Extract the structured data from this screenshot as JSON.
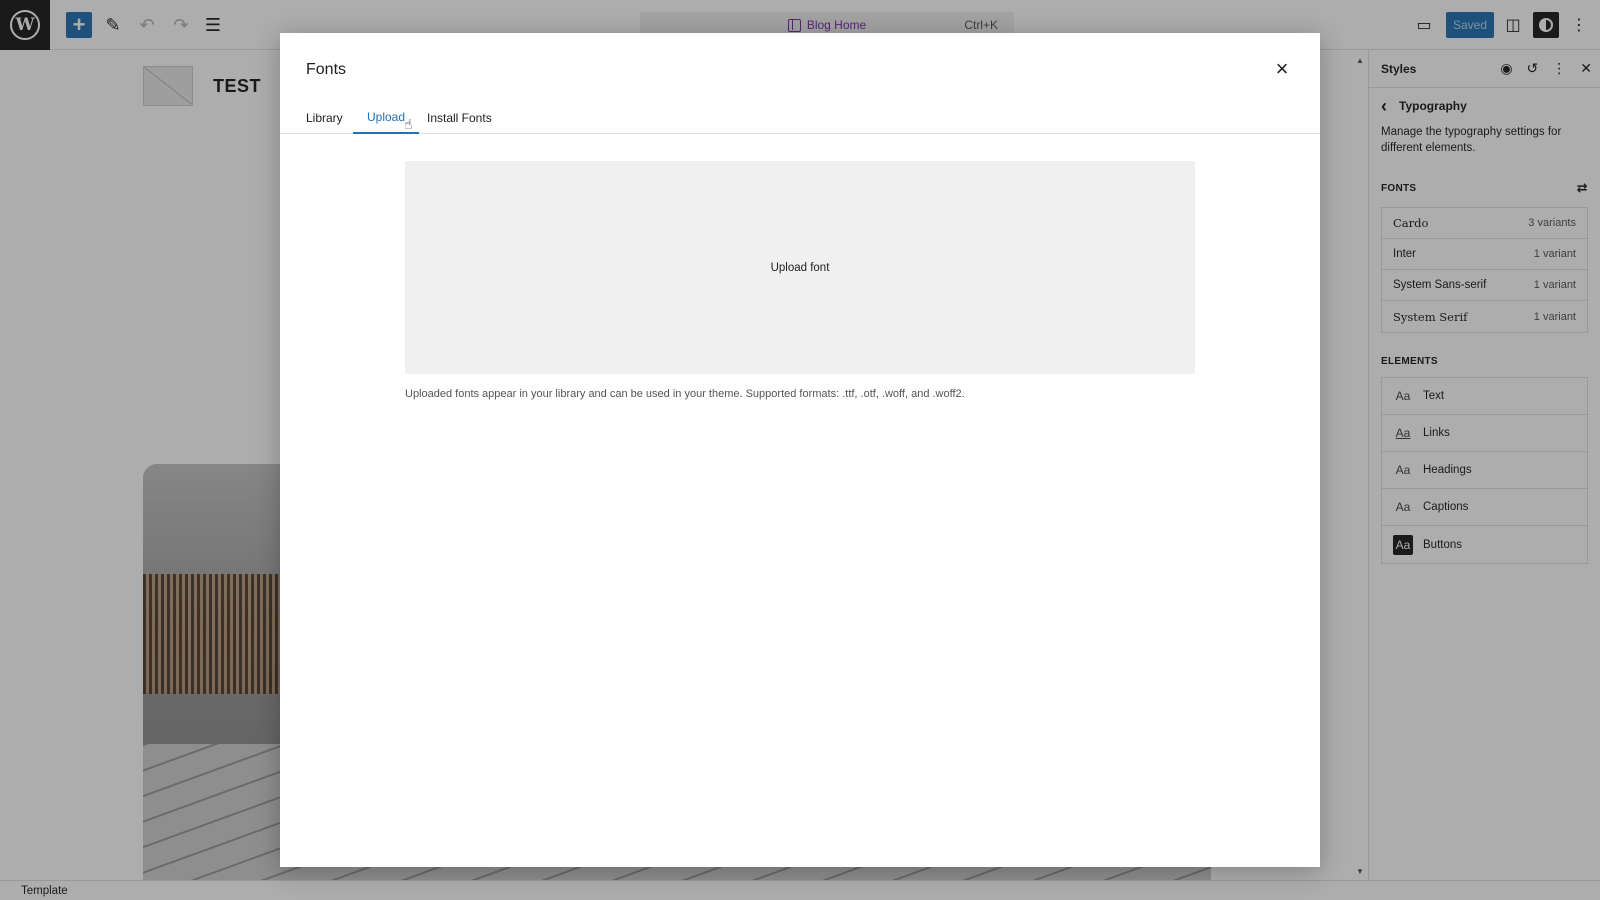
{
  "topbar": {
    "wp_logo": "W",
    "add_icon": "+",
    "command": {
      "title": "Blog Home",
      "shortcut": "Ctrl+K"
    },
    "saved_label": "Saved"
  },
  "canvas": {
    "site_title": "TEST"
  },
  "modal": {
    "title": "Fonts",
    "close_icon": "×",
    "tabs": [
      {
        "label": "Library"
      },
      {
        "label": "Upload"
      },
      {
        "label": "Install Fonts"
      }
    ],
    "active_tab": "Upload",
    "upload_label": "Upload font",
    "help_text": "Uploaded fonts appear in your library and can be used in your theme. Supported formats: .ttf, .otf, .woff, and .woff2."
  },
  "styles_panel": {
    "title": "Styles",
    "back_icon": "‹",
    "section_title": "Typography",
    "description": "Manage the typography settings for different elements.",
    "fonts_heading": "FONTS",
    "fonts": [
      {
        "name": "Cardo",
        "variants": "3 variants"
      },
      {
        "name": "Inter",
        "variants": "1 variant"
      },
      {
        "name": "System Sans-serif",
        "variants": "1 variant"
      },
      {
        "name": "System Serif",
        "variants": "1 variant"
      }
    ],
    "elements_heading": "ELEMENTS",
    "elements": [
      {
        "label": "Text",
        "icon": "Aa"
      },
      {
        "label": "Links",
        "icon": "Aa"
      },
      {
        "label": "Headings",
        "icon": "Aa"
      },
      {
        "label": "Captions",
        "icon": "Aa"
      },
      {
        "label": "Buttons",
        "icon": "Aa"
      }
    ]
  },
  "footer": {
    "breadcrumb": "Template"
  },
  "colors": {
    "accent": "#2271b1",
    "template_purple": "#7a2fa5"
  }
}
